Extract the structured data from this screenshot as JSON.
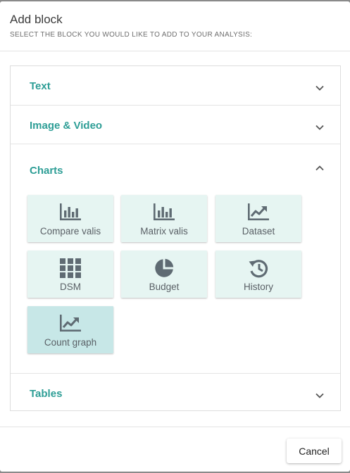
{
  "dialog": {
    "title": "Add block",
    "subtitle": "SELECT THE BLOCK YOU WOULD LIKE TO ADD TO YOUR ANALYSIS:"
  },
  "sections": {
    "text": {
      "label": "Text",
      "state": "collapsed",
      "icon": "chevron-down-icon"
    },
    "image_video": {
      "label": "Image & Video",
      "state": "collapsed",
      "icon": "chevron-down-icon"
    },
    "charts": {
      "label": "Charts",
      "state": "expanded",
      "icon": "chevron-up-icon",
      "tiles": [
        {
          "label": "Compare valis",
          "icon": "bar-chart-icon"
        },
        {
          "label": "Matrix valis",
          "icon": "bar-chart-icon"
        },
        {
          "label": "Dataset",
          "icon": "line-trend-icon"
        },
        {
          "label": "DSM",
          "icon": "grid-icon"
        },
        {
          "label": "Budget",
          "icon": "pie-chart-icon"
        },
        {
          "label": "History",
          "icon": "history-icon"
        },
        {
          "label": "Count graph",
          "icon": "line-trend-icon",
          "selected": true
        }
      ]
    },
    "tables": {
      "label": "Tables",
      "state": "collapsed",
      "icon": "chevron-down-icon"
    }
  },
  "footer": {
    "cancel_label": "Cancel"
  },
  "colors": {
    "accent": "#2e9e96",
    "tile_bg": "#e6f5f2",
    "tile_selected_bg": "#c7e7e7",
    "icon": "#5f6b73"
  }
}
